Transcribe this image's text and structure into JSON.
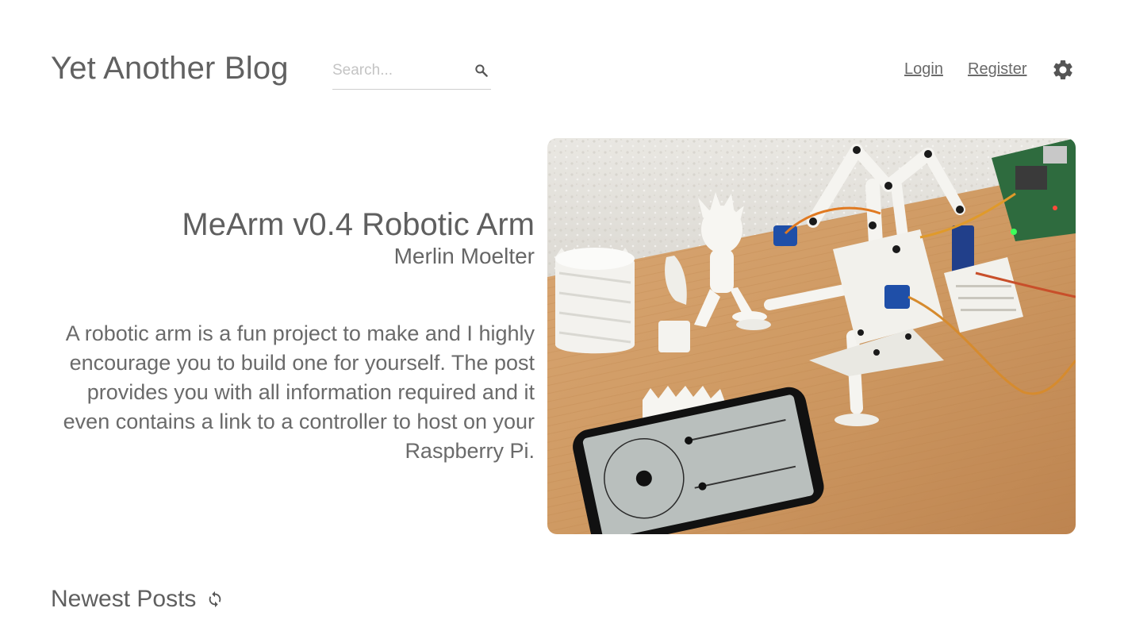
{
  "header": {
    "site_title": "Yet Another Blog",
    "search_placeholder": "Search...",
    "search_value": "",
    "search_icon": "search-icon",
    "nav": {
      "login_label": "Login",
      "register_label": "Register"
    },
    "settings_icon": "gear-icon"
  },
  "featured_post": {
    "title": "MeArm v0.4 Robotic Arm",
    "author": "Merlin Moelter",
    "excerpt": "A robotic arm is a fun project to make and I highly encourage you to build one for yourself. The post provides you with all information required and it even contains a link to a controller to host on your Raspberry Pi."
  },
  "newest_section": {
    "title": "Newest Posts",
    "refresh_icon": "refresh-icon"
  },
  "colors": {
    "text": "#5f5f5f",
    "background": "#ffffff",
    "link": "#6a6a6a",
    "icon": "#555555"
  }
}
